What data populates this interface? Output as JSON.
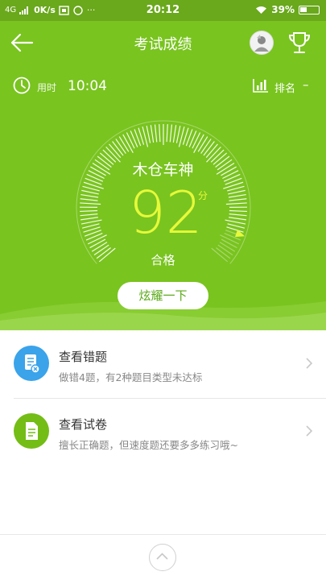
{
  "status_bar": {
    "network": "4G",
    "speed": "0K/s",
    "more": "···",
    "time": "20:12",
    "battery": "39%"
  },
  "header": {
    "title": "考试成绩"
  },
  "stats": {
    "time_label": "用时",
    "time_value": "10:04",
    "rank_label": "排名",
    "rank_value": "–"
  },
  "result": {
    "nickname": "木仓车神",
    "score": "92",
    "score_unit": "分",
    "status": "合格",
    "gauge_level_percent": 92,
    "share_button": "炫耀一下"
  },
  "items": [
    {
      "title": "查看错题",
      "desc": "做错4题，有2种题目类型未达标"
    },
    {
      "title": "查看试卷",
      "desc": "擅长正确题，但速度题还要多多练习哦~"
    }
  ],
  "colors": {
    "header_green": "#79c41f",
    "score_yellow": "#e6f93a",
    "blue_icon": "#3aa3ea",
    "green_icon": "#74bd16"
  }
}
